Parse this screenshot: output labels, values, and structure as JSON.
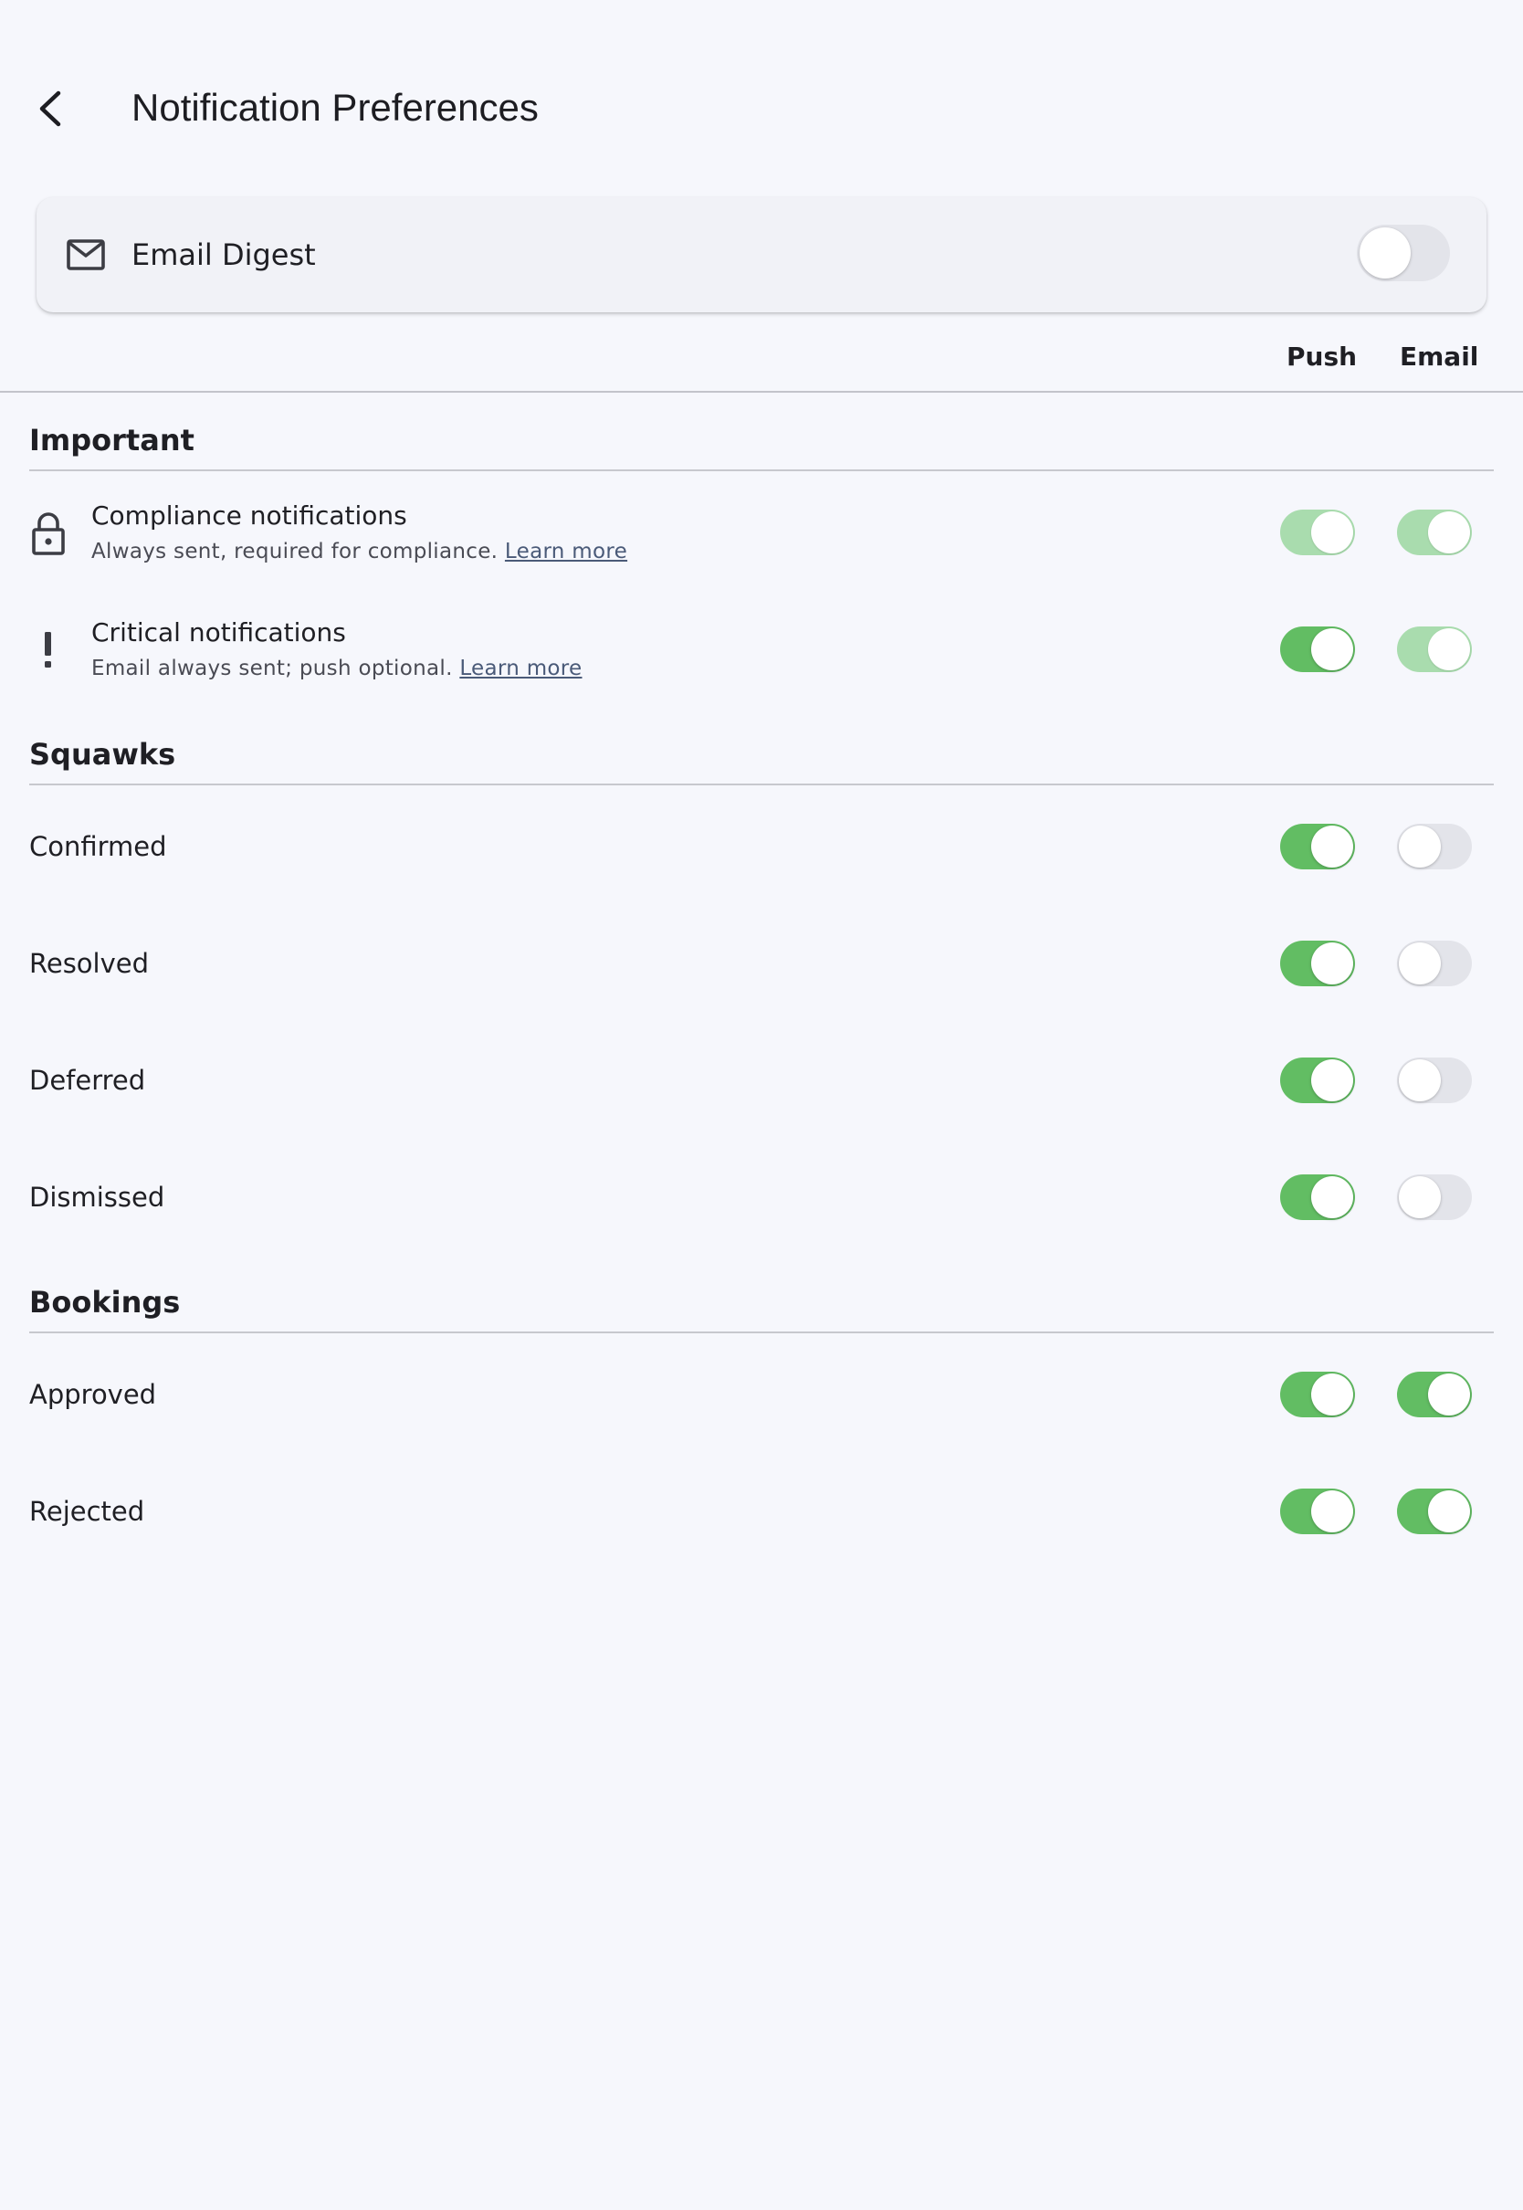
{
  "header": {
    "title": "Notification Preferences",
    "back_icon": "chevron-left-icon"
  },
  "digest": {
    "label": "Email Digest",
    "icon": "mail-icon",
    "enabled": false
  },
  "columns": {
    "push": "Push",
    "email": "Email"
  },
  "sections": {
    "important": {
      "title": "Important",
      "rows": [
        {
          "title": "Compliance notifications",
          "subtitle": "Always sent, required for compliance.",
          "link": "Learn more",
          "icon": "lock-icon",
          "push": "on-disabled",
          "email": "on-disabled"
        },
        {
          "title": "Critical notifications",
          "subtitle": "Email always sent; push optional.",
          "link": "Learn more",
          "icon": "exclamation-icon",
          "push": "on",
          "email": "on-disabled"
        }
      ]
    },
    "squawks": {
      "title": "Squawks",
      "rows": [
        {
          "label": "Confirmed",
          "push": "on",
          "email": "off"
        },
        {
          "label": "Resolved",
          "push": "on",
          "email": "off"
        },
        {
          "label": "Deferred",
          "push": "on",
          "email": "off"
        },
        {
          "label": "Dismissed",
          "push": "on",
          "email": "off"
        }
      ]
    },
    "bookings": {
      "title": "Bookings",
      "rows": [
        {
          "label": "Approved",
          "push": "on",
          "email": "on"
        },
        {
          "label": "Rejected",
          "push": "on",
          "email": "on"
        }
      ]
    }
  },
  "colors": {
    "toggle_on": "#62bd63",
    "toggle_on_disabled": "#a9dcae",
    "toggle_off": "#e3e4ea",
    "background": "#f6f7fc"
  }
}
